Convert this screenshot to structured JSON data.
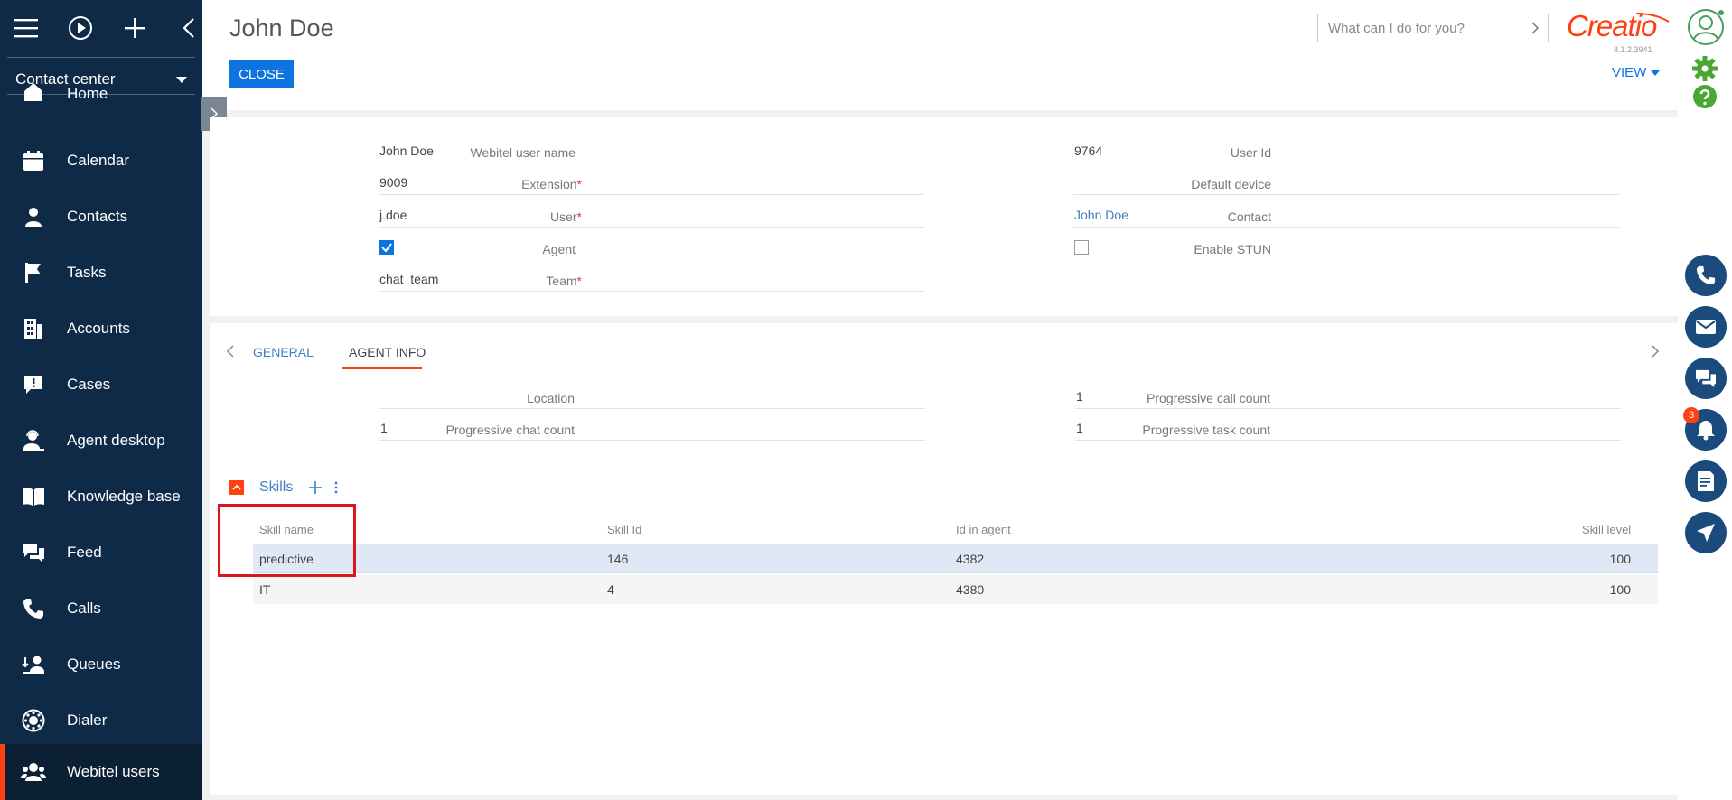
{
  "sidebar": {
    "workspace": "Contact center",
    "items": [
      {
        "label": "Home",
        "icon": "home-icon"
      },
      {
        "label": "Calendar",
        "icon": "calendar-icon"
      },
      {
        "label": "Contacts",
        "icon": "contacts-icon"
      },
      {
        "label": "Tasks",
        "icon": "tasks-flag-icon"
      },
      {
        "label": "Accounts",
        "icon": "accounts-building-icon"
      },
      {
        "label": "Cases",
        "icon": "cases-icon"
      },
      {
        "label": "Agent desktop",
        "icon": "agent-desktop-icon"
      },
      {
        "label": "Knowledge base",
        "icon": "knowledge-base-book-icon"
      },
      {
        "label": "Feed",
        "icon": "feed-icon"
      },
      {
        "label": "Calls",
        "icon": "calls-phone-icon"
      },
      {
        "label": "Queues",
        "icon": "queues-icon"
      },
      {
        "label": "Dialer",
        "icon": "dialer-icon"
      },
      {
        "label": "Webitel users",
        "icon": "webitel-users-icon",
        "active": true
      }
    ]
  },
  "header": {
    "title": "John Doe",
    "close_label": "CLOSE",
    "search_placeholder": "What can I do for you?",
    "logo": "Creatio",
    "version": "8.1.2.3941",
    "view_label": "VIEW"
  },
  "form": {
    "webitel_user_name": {
      "label": "Webitel user name",
      "value": "John Doe"
    },
    "extension": {
      "label": "Extension",
      "value": "9009"
    },
    "user": {
      "label": "User",
      "value": "j.doe"
    },
    "agent": {
      "label": "Agent",
      "checked": true
    },
    "team": {
      "label": "Team",
      "value": "chat  team"
    },
    "user_id": {
      "label": "User Id",
      "value": "9764"
    },
    "default_device": {
      "label": "Default device",
      "value": ""
    },
    "contact": {
      "label": "Contact",
      "value": "John Doe"
    },
    "enable_stun": {
      "label": "Enable STUN",
      "checked": false
    }
  },
  "tabs": {
    "general": "GENERAL",
    "agent_info": "AGENT INFO"
  },
  "agent_info": {
    "location": {
      "label": "Location",
      "value": ""
    },
    "progressive_call_count": {
      "label": "Progressive call count",
      "value": "1"
    },
    "progressive_chat_count": {
      "label": "Progressive chat count",
      "value": "1"
    },
    "progressive_task_count": {
      "label": "Progressive task count",
      "value": "1"
    }
  },
  "skills": {
    "title": "Skills",
    "columns": [
      "Skill name",
      "Skill Id",
      "Id in agent",
      "Skill level"
    ],
    "rows": [
      {
        "name": "predictive",
        "id": "146",
        "id_in_agent": "4382",
        "level": "100"
      },
      {
        "name": "IT",
        "id": "4",
        "id_in_agent": "4380",
        "level": "100"
      }
    ]
  },
  "right_panel": {
    "notification_count": "3",
    "buttons": [
      "phone-icon",
      "email-icon",
      "chat-icon",
      "bell-icon",
      "document-icon",
      "send-icon"
    ]
  },
  "colors": {
    "sidebar": "#0e2a47",
    "accent": "#ff4013",
    "primary": "#0d73de",
    "link": "#3f7ec4"
  }
}
